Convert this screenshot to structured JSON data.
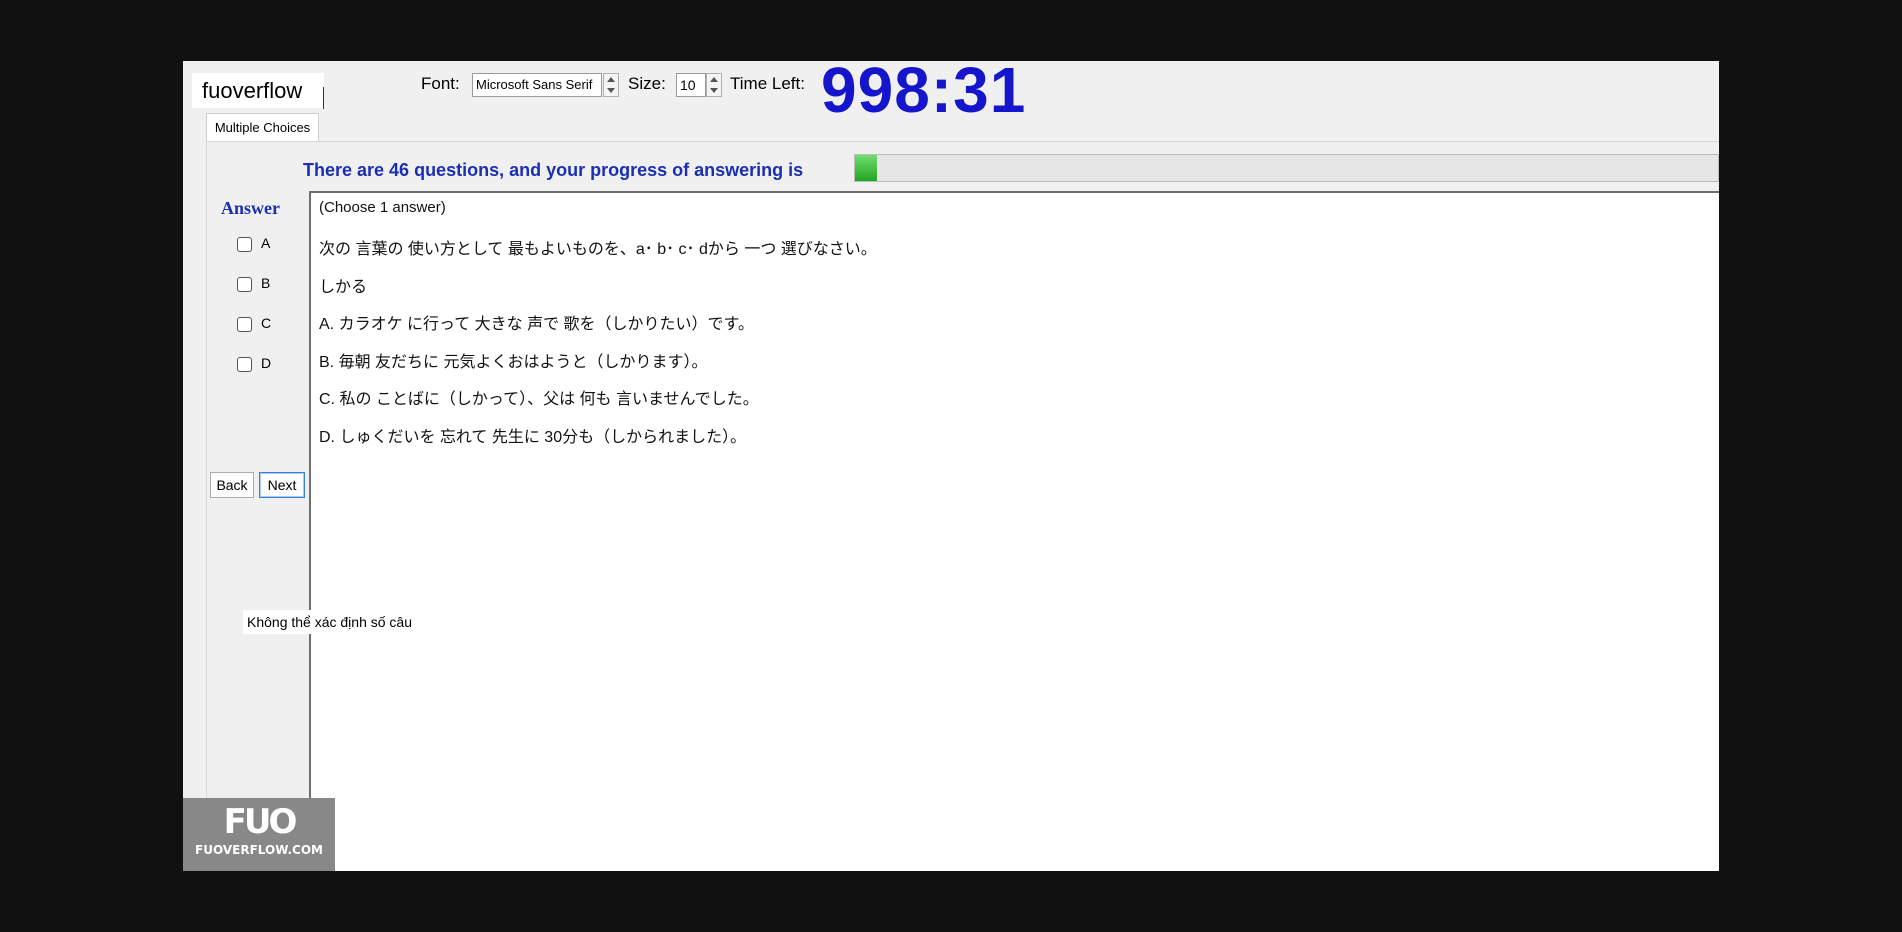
{
  "brand": {
    "name": "fuoverflow"
  },
  "toolbar": {
    "font_label": "Font:",
    "font_value": "Microsoft Sans Serif",
    "size_label": "Size:",
    "size_value": "10",
    "time_left_label": "Time Left:",
    "timer": "998:31"
  },
  "tabs": [
    {
      "label": "Multiple Choices"
    }
  ],
  "progress": {
    "text": "There are 46 questions, and your progress of answering is",
    "fraction": 0.025,
    "fill_color": "#33bb33"
  },
  "answer": {
    "label": "Answer",
    "options": [
      {
        "label": "A",
        "checked": false
      },
      {
        "label": "B",
        "checked": false
      },
      {
        "label": "C",
        "checked": false
      },
      {
        "label": "D",
        "checked": false
      }
    ]
  },
  "nav": {
    "back_label": "Back",
    "next_label": "Next"
  },
  "status": {
    "text": "Không thể xác định số câu"
  },
  "question": {
    "lines": [
      "(Choose 1 answer)",
      "次の 言葉の 使い方として 最もよいものを、a･ b･ c･ dから 一つ 選びなさい。",
      "しかる",
      "A. カラオケ に行って 大きな 声で 歌を（しかりたい）です。",
      "B. 毎朝 友だちに 元気よくおはようと（しかります）。",
      "C. 私の ことばに（しかって）、父は 何も 言いませんでした。",
      "D. しゅくだいを 忘れて 先生に 30分も（しかられました）。"
    ]
  },
  "watermark": {
    "mark": "FUO",
    "text": "FUOVERFLOW.COM"
  },
  "colors": {
    "timer": "#1515cc",
    "heading_blue": "#1a2fb4",
    "background": "#111111"
  }
}
